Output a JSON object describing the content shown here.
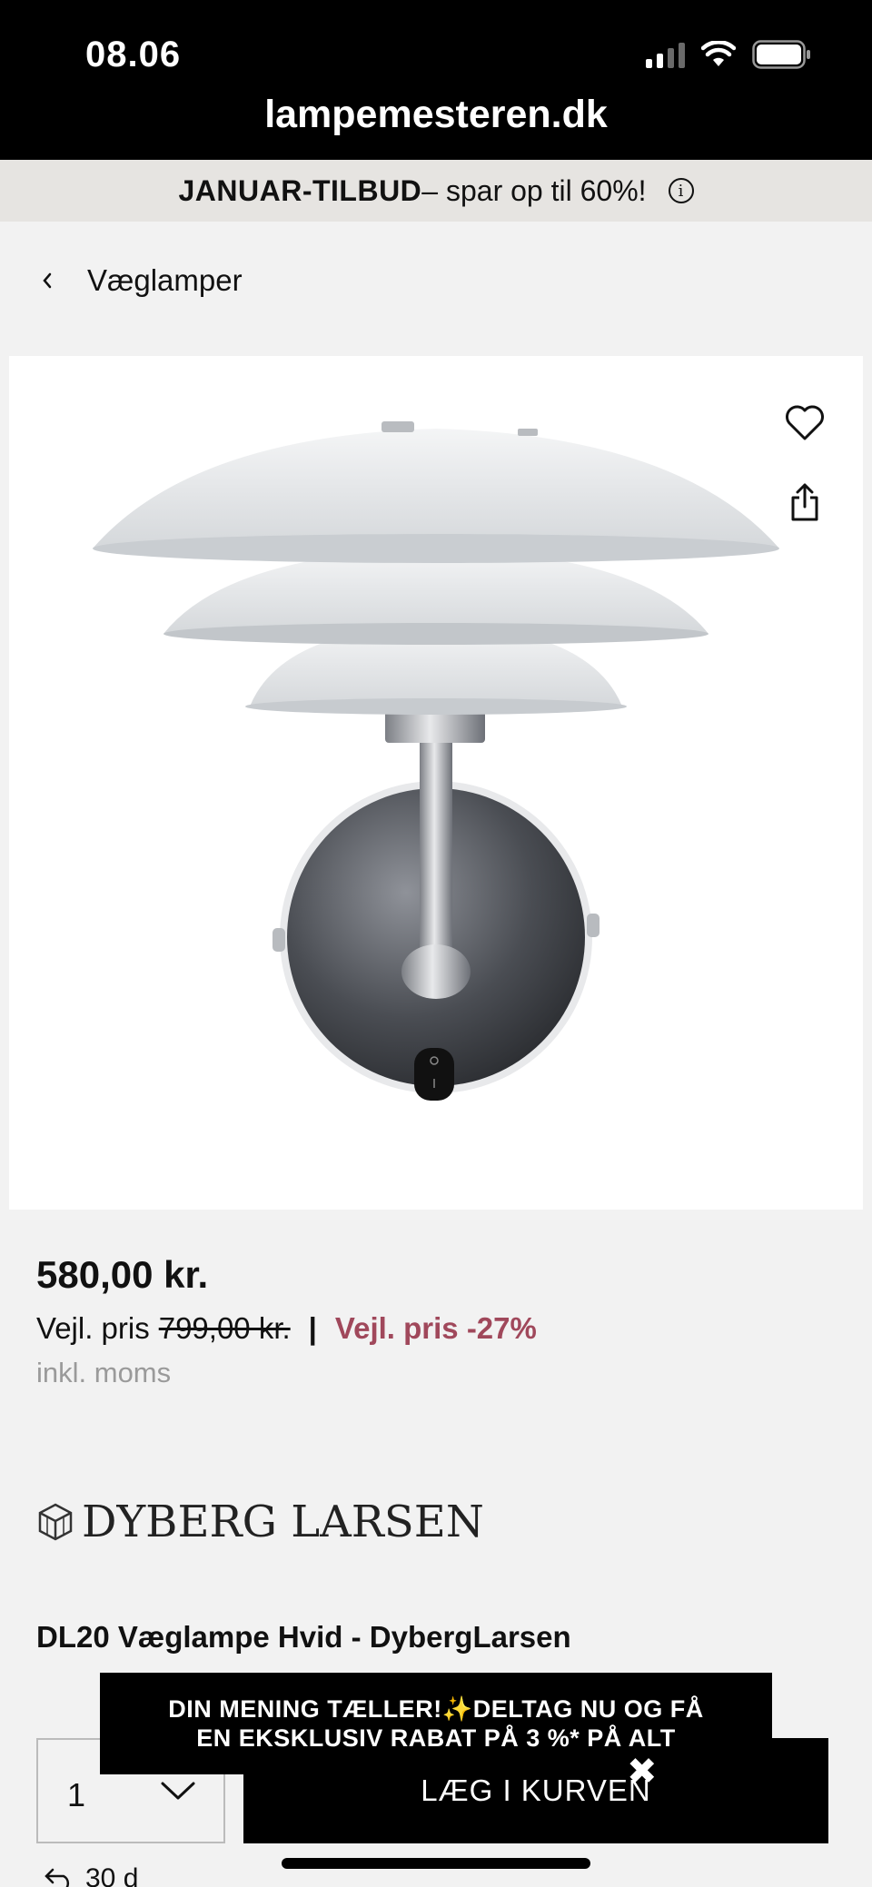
{
  "status_bar": {
    "time": "08.06",
    "url": "lampemesteren.dk"
  },
  "promo": {
    "bold": "JANUAR-TILBUD",
    "text": " – spar op til 60%!",
    "info_icon": "info-icon"
  },
  "breadcrumb": {
    "label": "Væglamper"
  },
  "product": {
    "price": "580,00 kr.",
    "suggested_label": "Vejl. pris",
    "suggested_price": "799,00 kr.",
    "separator": "|",
    "discount": "Vejl. pris -27%",
    "vat_note": "inkl. moms",
    "brand": "DYBERG LARSEN",
    "title": "DL20 Væglampe Hvid - DybergLarsen"
  },
  "purchase": {
    "quantity": "1",
    "add_to_cart": "LÆG I KURVEN"
  },
  "survey": {
    "line1": "DIN MENING TÆLLER!✨DELTAG NU OG FÅ",
    "line2": "EN EKSKLUSIV RABAT PÅ 3 %* PÅ ALT",
    "close": "✖"
  },
  "bottom": {
    "text": "30 d"
  },
  "colors": {
    "discount": "#a0485b",
    "black": "#000000",
    "promo_bg": "#e6e4e1"
  }
}
